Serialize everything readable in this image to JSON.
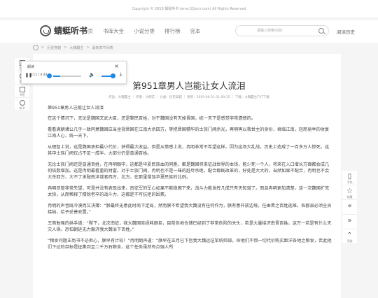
{
  "topbar": {
    "copyright": "Copyright © 2018 蜻蜓听书 (ems.52jscn.com) All Rights Reserved"
  },
  "header": {
    "logo_text": "蜻蜓听书",
    "nav": [
      "首页",
      "书库大全",
      "小说分类",
      "排行榜",
      "完本"
    ],
    "search_placeholder": "请输入搜索内容!",
    "history": "阅读历史"
  },
  "breadcrumb": [
    "历史穿越",
    "大魏霸主",
    "最新章节列表"
  ],
  "left_tools": [
    {
      "icon": "list-icon",
      "label": "目录"
    },
    {
      "icon": "gear-icon",
      "label": "设置"
    },
    {
      "icon": "bookmark-icon",
      "label": "书签"
    },
    {
      "icon": "audio-icon",
      "label": "听书"
    }
  ],
  "player": {
    "label": "朗读",
    "time": "0:11 / 0:44",
    "progress": 0.25,
    "volume": 0.8
  },
  "chapter": {
    "title": "第951章男人岂能让女人流泪",
    "meta": "作品：大魏霸主 ｜ 作者：沙明志 ｜ 分类：历史穿越 ｜ 更新：2019-06-21 01:09:15 ｜ 下载：大魏霸主TXT下载",
    "paragraphs": [
      "第951章男人岂能让女人流泪",
      "在这个情况下，无论是魏国文武大臣，还是黎民百姓，对于魏国没有灭掉晋国，统一天下是感觉非常遗憾的。",
      "看看满朝诸公几乎一致同意魏国应当坐视晋国在江南大杀四方，等把晋国精华的士族门阀杀光，再明再以救世主的身份，君临江南，轻而易举的收复江南人心，统一天下。",
      "从理智上说，这是魏国承担最小代价，获得最大收益。但是从情感上说，冉明非常不希望这样。因为这场大乱战，历史上造成了一百多万人惨死，这其中士族门阀仅占不足一成半，大部分仍是普通百姓。",
      "无论士族门阀还是普通百姓，在冉明眼中，这都是华夏民族血肉同胞，都是魏国将来征战世界的本钱，能少死一个人，将来在入口增长方面都会成几何倍数增加。这是冉明最看重的财富。对于士族门阀，冉明也不是一味的赶尽杀绝，配合都既改革的，好处是大大的，当然如果不配合，冉明也不会大杀四方，大不了发配南洋或者西方，北方，在那里增加华夏民族的比例。",
      "冉明尽管非常失望，可是并没有表现出来，南征军的军心如果不能稳固下来，战斗力能发挥几成只有天知道了。而且冉明更加清楚，这一次魏国扩充太快，从而稀释了精锐老卒的战斗力，这都是不可抗拒的因素。",
      "冉明的声音既冷漠而又决薄：“朕最终无意此时南下定局，然而朕不希望我大魏没有任何作为，朕有意开放边境，任由晋之百姓逃难，各郡县必须全员接纳，给予妥善安置。”",
      "王简勉强的拱手道：“陛下，北次南征，我大魏国库损耗颇巨，目前各地仓储已经到了非常危险的关头，若是大量接济南晋百姓，这万一若是有什么天灾人祸，恐怕朝廷无力赈济我大魏治下百姓。”",
      "“粮食问题王尚书不必担心，朕早有计较！”冉明朗声道：“朕早在正月已下旨我大魏远征军统帅部，命他们不惜一切代价购买距洋各地之粮食，若此他们下达的目标是征集到至二千万石粮食，这个任务虽然有点强人所"
    ]
  },
  "right_tools": [
    {
      "icon": "phone-icon",
      "label": "手机"
    },
    {
      "icon": "star-icon",
      "label": "收藏"
    },
    {
      "icon": "prev-icon",
      "label": ""
    },
    {
      "icon": "next-icon",
      "label": ""
    },
    {
      "icon": "top-icon",
      "label": "顶部"
    }
  ]
}
